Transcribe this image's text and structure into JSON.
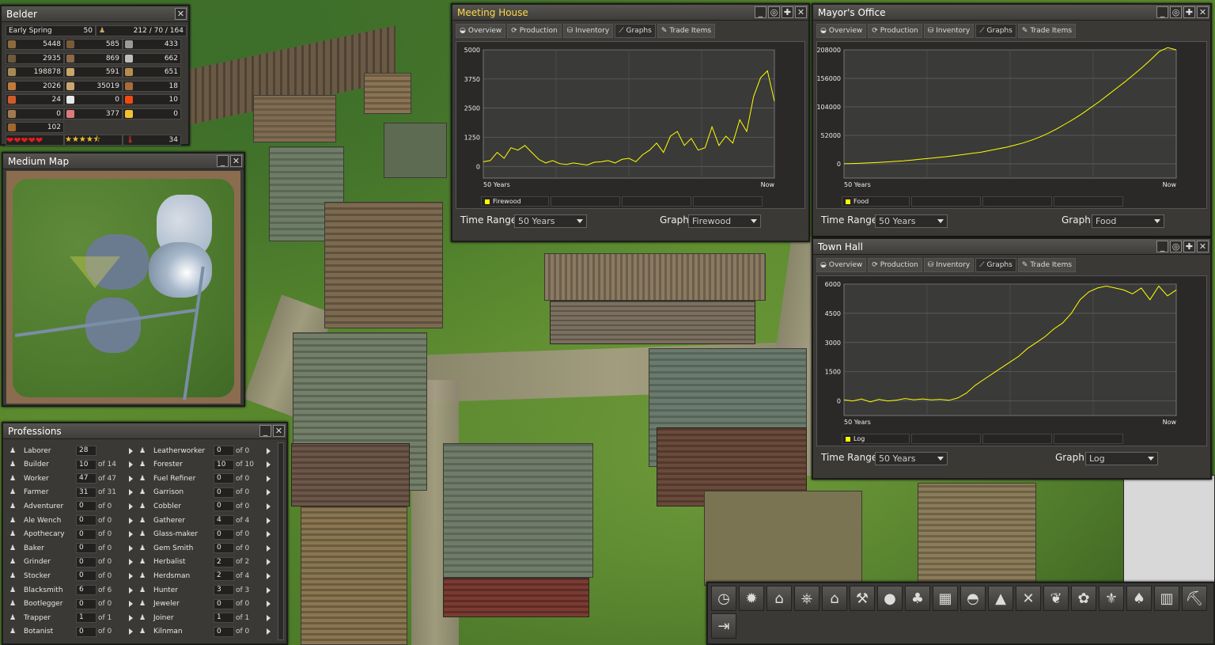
{
  "resources": {
    "title": "Belder",
    "season": "Early Spring",
    "season_num": "50",
    "population": "212 / 70 / 164",
    "rows": [
      [
        "5448",
        "585",
        "433"
      ],
      [
        "2935",
        "869",
        "662"
      ],
      [
        "198878",
        "591",
        "651"
      ],
      [
        "2026",
        "35019",
        "18"
      ],
      [
        "24",
        "0",
        "10"
      ],
      [
        "0",
        "377",
        "0"
      ]
    ],
    "single": "102",
    "health_hearts": "❤❤❤❤❤",
    "happiness": "★★★★⯪",
    "temperature": "34"
  },
  "minimap": {
    "title": "Medium Map"
  },
  "professions": {
    "title": "Professions",
    "left": [
      {
        "name": "Laborer",
        "val": "28",
        "of": ""
      },
      {
        "name": "Builder",
        "val": "10",
        "of": "of 14"
      },
      {
        "name": "Worker",
        "val": "47",
        "of": "of 47"
      },
      {
        "name": "Farmer",
        "val": "31",
        "of": "of 31"
      },
      {
        "name": "Adventurer",
        "val": "0",
        "of": "of 0"
      },
      {
        "name": "Ale Wench",
        "val": "0",
        "of": "of 0"
      },
      {
        "name": "Apothecary",
        "val": "0",
        "of": "of 0"
      },
      {
        "name": "Baker",
        "val": "0",
        "of": "of 0"
      },
      {
        "name": "Grinder",
        "val": "0",
        "of": "of 0"
      },
      {
        "name": "Stocker",
        "val": "0",
        "of": "of 0"
      },
      {
        "name": "Blacksmith",
        "val": "6",
        "of": "of 6"
      },
      {
        "name": "Bootlegger",
        "val": "0",
        "of": "of 0"
      },
      {
        "name": "Trapper",
        "val": "1",
        "of": "of 1"
      },
      {
        "name": "Botanist",
        "val": "0",
        "of": "of 0"
      }
    ],
    "right": [
      {
        "name": "Leatherworker",
        "val": "0",
        "of": "of 0"
      },
      {
        "name": "Forester",
        "val": "10",
        "of": "of 10"
      },
      {
        "name": "Fuel Refiner",
        "val": "0",
        "of": "of 0"
      },
      {
        "name": "Garrison",
        "val": "0",
        "of": "of 0"
      },
      {
        "name": "Cobbler",
        "val": "0",
        "of": "of 0"
      },
      {
        "name": "Gatherer",
        "val": "4",
        "of": "of 4"
      },
      {
        "name": "Glass-maker",
        "val": "0",
        "of": "of 0"
      },
      {
        "name": "Gem Smith",
        "val": "0",
        "of": "of 0"
      },
      {
        "name": "Herbalist",
        "val": "2",
        "of": "of 2"
      },
      {
        "name": "Herdsman",
        "val": "2",
        "of": "of 4"
      },
      {
        "name": "Hunter",
        "val": "3",
        "of": "of 3"
      },
      {
        "name": "Jeweler",
        "val": "0",
        "of": "of 0"
      },
      {
        "name": "Joiner",
        "val": "1",
        "of": "of 1"
      },
      {
        "name": "Kilnman",
        "val": "0",
        "of": "of 0"
      }
    ]
  },
  "tabs": [
    "Overview",
    "Production",
    "Inventory",
    "Graphs",
    "Trade Items"
  ],
  "labels": {
    "time_range": "Time Range",
    "graph": "Graph",
    "x_start": "50 Years",
    "x_end": "Now"
  },
  "windows": [
    {
      "title": "Meeting House",
      "range": "50 Years",
      "graph": "Firewood",
      "legend": "Firewood"
    },
    {
      "title": "Mayor's Office",
      "range": "50 Years",
      "graph": "Food",
      "legend": "Food"
    },
    {
      "title": "Town Hall",
      "range": "50 Years",
      "graph": "Log",
      "legend": "Log"
    }
  ],
  "chart_data": [
    {
      "type": "line",
      "title": "Meeting House",
      "series": [
        {
          "name": "Firewood",
          "values": [
            200,
            250,
            600,
            350,
            800,
            700,
            900,
            600,
            300,
            150,
            250,
            120,
            80,
            150,
            100,
            60,
            180,
            200,
            250,
            150,
            300,
            350,
            200,
            500,
            700,
            1000,
            600,
            1300,
            1500,
            900,
            1200,
            700,
            800,
            1700,
            900,
            1300,
            1000,
            2000,
            1500,
            3000,
            3800,
            4100,
            2800
          ]
        }
      ],
      "yticks": [
        "5000",
        "3750",
        "2500",
        "1250",
        "0"
      ],
      "ylim": [
        -500,
        5000
      ],
      "grid": true
    },
    {
      "type": "line",
      "title": "Mayor's Office",
      "series": [
        {
          "name": "Food",
          "values": [
            200,
            600,
            1200,
            1800,
            2500,
            3500,
            4500,
            5500,
            7000,
            8500,
            10000,
            11500,
            13000,
            15000,
            17000,
            19000,
            21000,
            24000,
            27000,
            30000,
            34000,
            38000,
            43000,
            49000,
            56000,
            64000,
            73000,
            82000,
            92000,
            103000,
            114000,
            126000,
            138000,
            150000,
            163000,
            176000,
            190000,
            205000,
            212000,
            208000
          ]
        }
      ],
      "yticks": [
        "208000",
        "156000",
        "104000",
        "52000",
        "0"
      ],
      "ylim": [
        -26000,
        208000
      ],
      "grid": true
    },
    {
      "type": "line",
      "title": "Town Hall",
      "series": [
        {
          "name": "Log",
          "values": [
            50,
            0,
            100,
            -50,
            80,
            0,
            40,
            120,
            60,
            100,
            50,
            80,
            30,
            150,
            400,
            800,
            1100,
            1400,
            1700,
            2000,
            2300,
            2700,
            3000,
            3300,
            3700,
            4000,
            4500,
            5200,
            5600,
            5800,
            5900,
            5800,
            5700,
            5500,
            5800,
            5200,
            5900,
            5400,
            5700
          ]
        }
      ],
      "yticks": [
        "6000",
        "4500",
        "3000",
        "1500",
        "0"
      ],
      "ylim": [
        -750,
        6000
      ],
      "grid": true
    }
  ],
  "toolbar": {
    "icons": [
      "clock-icon",
      "gear-icon",
      "house-icon",
      "wheel-icon",
      "barn-icon",
      "hammer-icon",
      "apple-icon",
      "tree-icon",
      "field-icon",
      "bowl-icon",
      "sack-icon",
      "tools-icon",
      "wheat-icon",
      "flowers-icon",
      "fleur-icon",
      "oak-icon",
      "market-icon",
      "axe-icon",
      "exit-icon"
    ]
  }
}
